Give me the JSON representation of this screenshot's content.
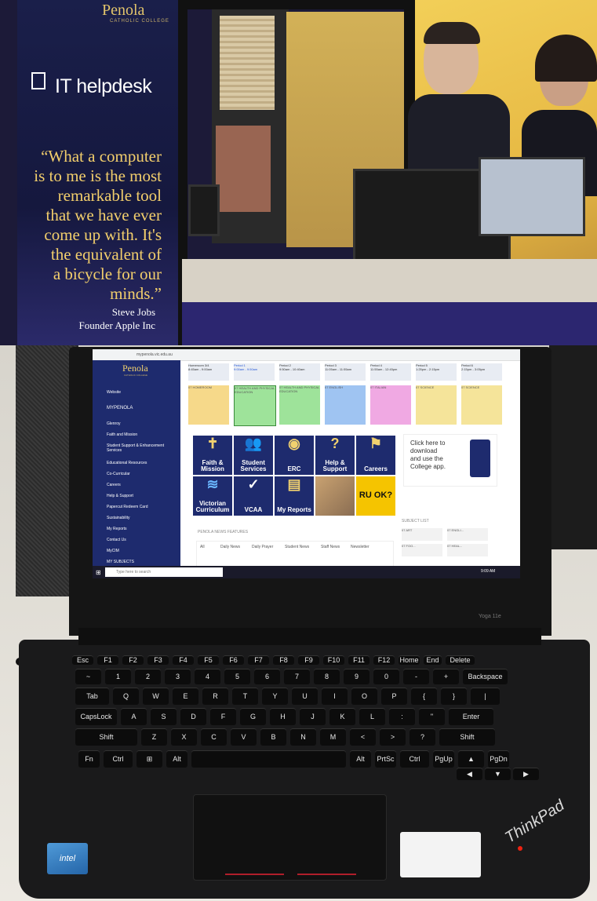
{
  "top_photo": {
    "brand": "Penola",
    "brand_sub": "CATHOLIC COLLEGE",
    "helpdesk_label": "IT helpdesk",
    "quote_lines": [
      "“What a computer",
      "is to me is the most",
      "remarkable tool",
      "that we have ever",
      "come up with. It's",
      "the equivalent of",
      "a bicycle for our",
      "minds.”"
    ],
    "author_name": "Steve Jobs",
    "author_title": "Founder Apple Inc"
  },
  "screen": {
    "address": "mypenola.vic.edu.au",
    "logo": "Penola",
    "logo_sub": "CATHOLIC COLLEGE",
    "sidebar_items": [
      "Website",
      "MYPENOLA",
      "Glenroy",
      "Faith and Mission",
      "Student Support & Enhancement Services",
      "Educational Resources",
      "Co-Curricular",
      "Careers",
      "Help & Support",
      "Papercut Redeem Card",
      "Sustainability",
      "My Reports",
      "Contact Us",
      "MyCIM",
      "MY SUBJECTS"
    ],
    "periods": [
      {
        "label": "Homeroom 3/4",
        "time": "8:45am - 9:00am"
      },
      {
        "label": "Period 1",
        "time": "9:00am - 9:50am"
      },
      {
        "label": "Period 2",
        "time": "9:50am - 10:40am"
      },
      {
        "label": "Period 3",
        "time": "11:05am - 11:55am"
      },
      {
        "label": "Period 4",
        "time": "11:55am - 12:45pm"
      },
      {
        "label": "Period 5",
        "time": "1:25pm - 2:15pm"
      },
      {
        "label": "Period 6",
        "time": "2:15pm - 3:05pm"
      }
    ],
    "classes": [
      "07 HOMEROOM",
      "07 HEALTH AND PHYSICAL EDUCATION",
      "07 HEALTH AND PHYSICAL EDUCATION",
      "07 ENGLISH",
      "07 ITALIAN",
      "07 SCIENCE",
      "07 SCIENCE"
    ],
    "tiles": [
      "Faith & Mission",
      "Student Services",
      "ERC",
      "Help & Support",
      "Careers",
      "Victorian Curriculum",
      "VCAA",
      "My Reports",
      "",
      "RU OK?"
    ],
    "promo": [
      "Click here to",
      "download",
      "and use the",
      "College app."
    ],
    "news_title": "PENOLA NEWS FEATURES",
    "news_tabs": [
      "All",
      "Daily News",
      "Daily Prayer",
      "Student News",
      "Staff News",
      "Newsletter"
    ],
    "subject_list_title": "SUBJECT LIST",
    "subjects": [
      "07 ART",
      "07 ENGLI...",
      "07 FOO...",
      "07 HEAL..."
    ],
    "search_placeholder": "Type here to search",
    "clock": "9:09 AM"
  },
  "laptop": {
    "model": "Yoga 11e",
    "brand": "ThinkPad",
    "intel": "intel",
    "key_rows": [
      [
        "Esc",
        "F1",
        "F2",
        "F3",
        "F4",
        "F5",
        "F6",
        "F7",
        "F8",
        "F9",
        "F10",
        "F11",
        "F12",
        "Home",
        "End",
        "Delete"
      ],
      [
        "~",
        "1",
        "2",
        "3",
        "4",
        "5",
        "6",
        "7",
        "8",
        "9",
        "0",
        "-",
        "+",
        "Backspace"
      ],
      [
        "Tab",
        "Q",
        "W",
        "E",
        "R",
        "T",
        "Y",
        "U",
        "I",
        "O",
        "P",
        "{",
        "}",
        "|"
      ],
      [
        "CapsLock",
        "A",
        "S",
        "D",
        "F",
        "G",
        "H",
        "J",
        "K",
        "L",
        ":",
        "\"",
        "Enter"
      ],
      [
        "Shift",
        "Z",
        "X",
        "C",
        "V",
        "B",
        "N",
        "M",
        "<",
        ">",
        "?",
        "Shift"
      ],
      [
        "Fn",
        "Ctrl",
        "⊞",
        "Alt",
        "",
        "Alt",
        "PrtSc",
        "Ctrl",
        "PgUp",
        "▲",
        "PgDn"
      ]
    ],
    "arrow_keys": [
      "◀",
      "▼",
      "▶"
    ]
  },
  "colors": {
    "navy": "#1e2b6e",
    "gold": "#f1d16f",
    "ruok_yellow": "#f5c400"
  }
}
